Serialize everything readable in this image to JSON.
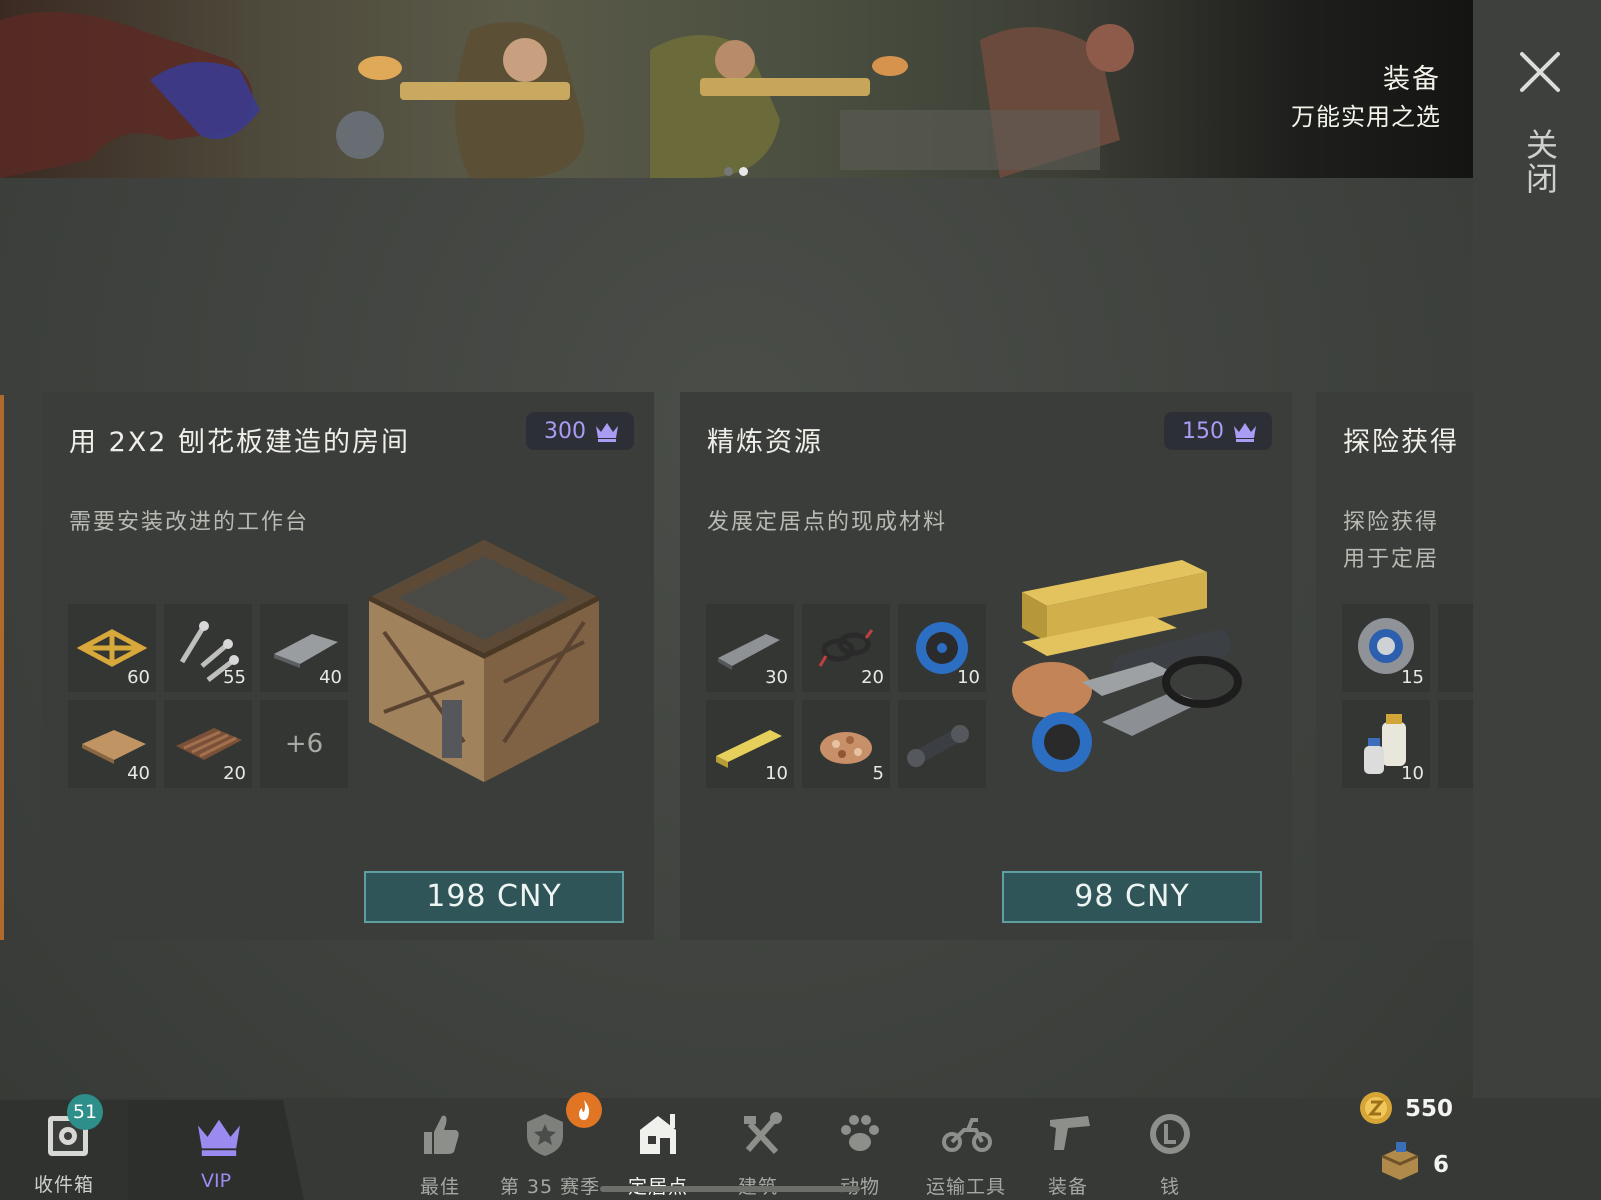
{
  "banner": {
    "title": "装备",
    "subtitle": "万能实用之选",
    "dots": 2,
    "active_dot": 2
  },
  "close": {
    "label": "关闭"
  },
  "cards": [
    {
      "title": "用 2X2 刨花板建造的房间",
      "description": "需要安装改进的工作台",
      "vip_points": "300",
      "items": [
        {
          "icon": "wood-frame-icon",
          "qty": "60"
        },
        {
          "icon": "screws-icon",
          "qty": "55"
        },
        {
          "icon": "metal-plate-icon",
          "qty": "40"
        },
        {
          "icon": "wood-board-icon",
          "qty": "40"
        },
        {
          "icon": "planks-icon",
          "qty": "20"
        }
      ],
      "more": "+6",
      "price": "198 CNY"
    },
    {
      "title": "精炼资源",
      "description": "发展定居点的现成材料",
      "vip_points": "150",
      "items": [
        {
          "icon": "metal-bar-icon",
          "qty": "30"
        },
        {
          "icon": "wire-icon",
          "qty": "20"
        },
        {
          "icon": "cable-spool-icon",
          "qty": "10"
        },
        {
          "icon": "lumber-icon",
          "qty": "10"
        },
        {
          "icon": "wood-chips-icon",
          "qty": "5"
        },
        {
          "icon": "pipe-icon",
          "qty": ""
        }
      ],
      "price": "98 CNY"
    },
    {
      "title": "探险获得",
      "description_line1": "探险获得",
      "description_line2": "用于定居",
      "items": [
        {
          "icon": "bearing-icon",
          "qty": "15"
        },
        {
          "icon": "resin-bottles-icon",
          "qty": "10"
        }
      ]
    }
  ],
  "bottom_nav": {
    "inbox": {
      "label": "收件箱",
      "count": "51"
    },
    "vip": {
      "label": "VIP"
    },
    "tabs": [
      {
        "label": "最佳",
        "icon": "thumbs-up-icon"
      },
      {
        "label": "第 35 赛季",
        "icon": "season-shield-icon"
      },
      {
        "label": "定居点",
        "icon": "settlement-icon"
      },
      {
        "label": "建筑",
        "icon": "hammer-wrench-icon"
      },
      {
        "label": "动物",
        "icon": "paw-icon"
      },
      {
        "label": "运输工具",
        "icon": "motorcycle-icon"
      },
      {
        "label": "装备",
        "icon": "pistol-icon"
      },
      {
        "label": "钱",
        "icon": "coin-icon"
      }
    ],
    "active_tab": "定居点"
  },
  "currency": {
    "coins": "550",
    "crates": "6"
  },
  "colors": {
    "vip_purple": "#a99cf5",
    "buy_button": "#2f5558",
    "badge_teal": "#2e8f8a",
    "fire_orange": "#e07623"
  }
}
